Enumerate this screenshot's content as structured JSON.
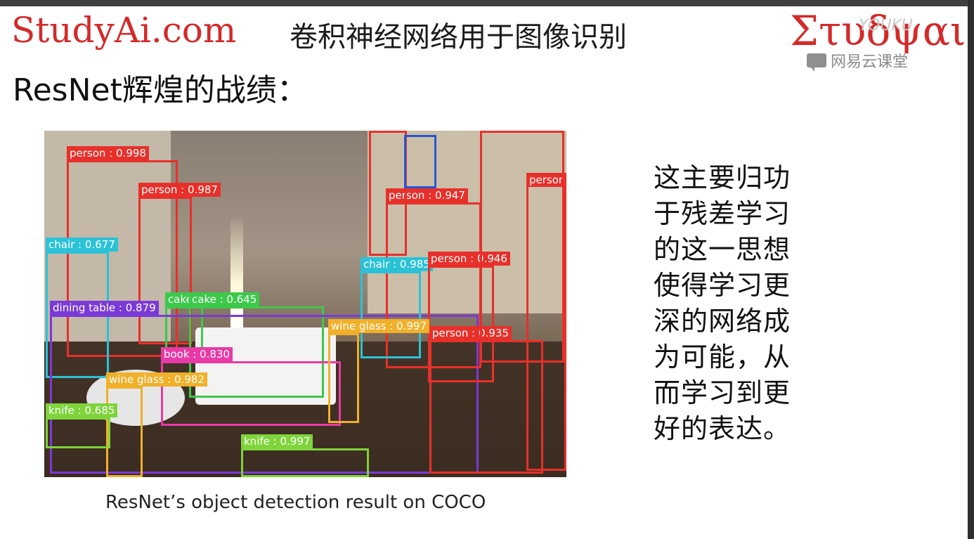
{
  "header": {
    "brand": "StudyAi.com",
    "course_title": "卷积神经网络用于图像识别",
    "greek_logo": "Στυδψαι",
    "watermark": "网易云课堂",
    "youku": "YOUKU"
  },
  "slide": {
    "heading": "ResNet辉煌的战绩：",
    "side_text": "这主要归功于残差学习的这一思想使得学习更深的网络成为可能，从而学习到更好的表达。",
    "caption": "ResNet’s object detection result on COCO"
  },
  "detections": [
    {
      "label": "person : 0.998",
      "color": "#e8302a"
    },
    {
      "label": "person : 0.987",
      "color": "#e8302a"
    },
    {
      "label": "chair : 0.677",
      "color": "#2bc2d8"
    },
    {
      "label": "cake",
      "color": "#3cc94a"
    },
    {
      "label": "cake : 0.645",
      "color": "#3cc94a"
    },
    {
      "label": "dining table : 0.879",
      "color": "#7a3ad6"
    },
    {
      "label": "book : 0.830",
      "color": "#e83aa6"
    },
    {
      "label": "wine glass : 0.982",
      "color": "#f0b02a"
    },
    {
      "label": "knife : 0.685",
      "color": "#7ed43a"
    },
    {
      "label": "knife : 0.997",
      "color": "#7ed43a"
    },
    {
      "label": "person : 0.947",
      "color": "#e8302a"
    },
    {
      "label": "person",
      "color": "#e8302a"
    },
    {
      "label": "chair : 0.985",
      "color": "#2bc2d8"
    },
    {
      "label": "person : 0.946",
      "color": "#e8302a"
    },
    {
      "label": "wine glass : 0.997",
      "color": "#f0b02a"
    },
    {
      "label": "person : 0.935",
      "color": "#e8302a"
    }
  ]
}
